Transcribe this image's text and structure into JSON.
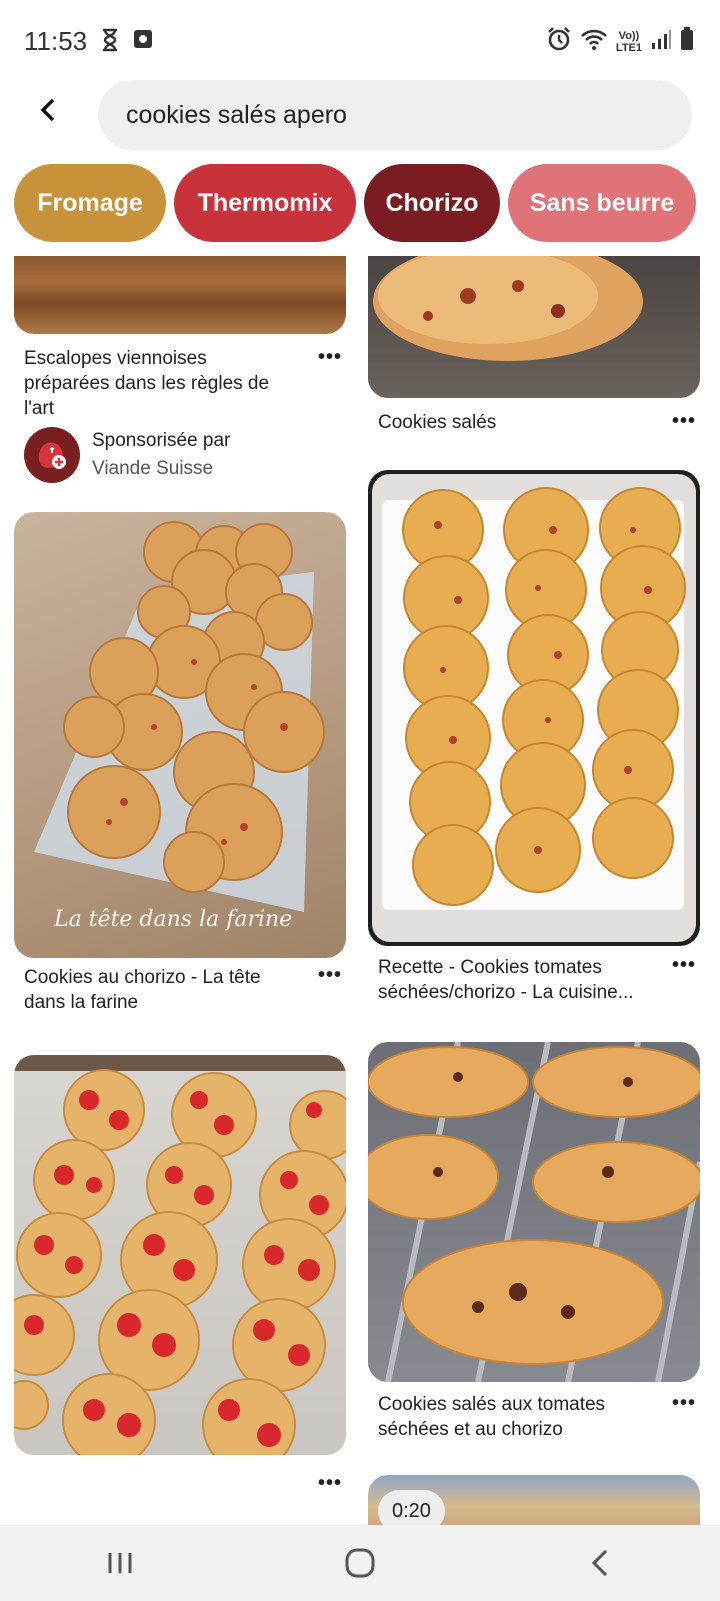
{
  "status_bar": {
    "time": "11:53",
    "network_label_top": "Vo))",
    "network_label_bottom": "LTE1",
    "left_icons": [
      "hourglass-icon",
      "screen-record-icon"
    ],
    "right_icons": [
      "alarm-icon",
      "wifi-icon",
      "signal-icon",
      "battery-icon"
    ]
  },
  "search": {
    "query": "cookies salés apero",
    "back_icon": "chevron-left-icon"
  },
  "chips": [
    {
      "label": "Fromage",
      "color": "#c8923a"
    },
    {
      "label": "Thermomix",
      "color": "#c8323b"
    },
    {
      "label": "Chorizo",
      "color": "#7a1c21"
    },
    {
      "label": "Sans beurre",
      "color": "#e07378"
    }
  ],
  "pins": {
    "left": [
      {
        "title": "Escalopes viennoises préparées dans les règles de l'art",
        "more": "•••"
      },
      {
        "title": "Cookies au chorizo - La tête dans la farine",
        "more": "•••",
        "watermark": "La tête dans la farine"
      },
      {
        "title": "",
        "more": "•••"
      }
    ],
    "right": [
      {
        "title": "Cookies salés",
        "more": "•••"
      },
      {
        "title": "Recette - Cookies tomates séchées/chorizo - La cuisine...",
        "more": "•••"
      },
      {
        "title": "Cookies salés aux tomates séchées et au chorizo",
        "more": "•••"
      },
      {
        "title": "",
        "video_duration": "0:20"
      }
    ]
  },
  "sponsor": {
    "line1": "Sponsorisée par",
    "line2": "Viande Suisse"
  },
  "nav_bar": {
    "buttons": [
      "recent-apps-icon",
      "home-icon",
      "back-icon"
    ]
  }
}
